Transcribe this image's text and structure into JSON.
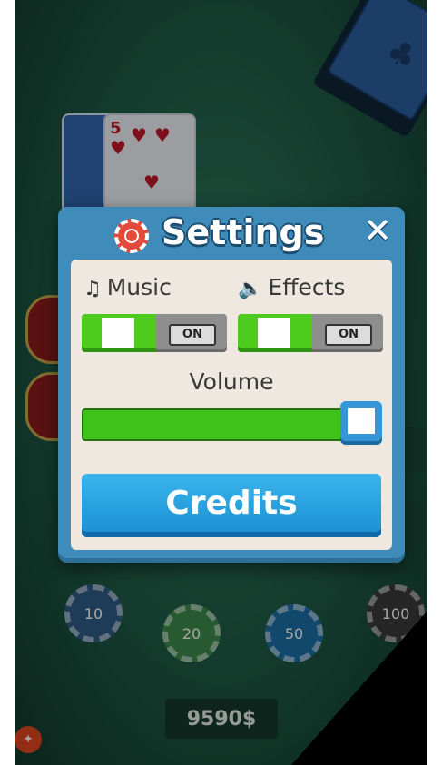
{
  "modal": {
    "title": "Settings",
    "close_symbol": "✕",
    "music": {
      "icon": "music-note-icon",
      "label": "Music",
      "state": "ON"
    },
    "effects": {
      "icon": "speaker-icon",
      "label": "Effects",
      "state": "ON"
    },
    "volume": {
      "label": "Volume",
      "level_percent": 100
    },
    "credits_label": "Credits"
  },
  "background": {
    "card_rank": "5",
    "chips": [
      "10",
      "20",
      "50",
      "100"
    ],
    "balance": "9590$"
  },
  "colors": {
    "modal_blue": "#3f8cbb",
    "toggle_green": "#4ecb1c",
    "credits_blue": "#1a8ed2",
    "table_green": "#2f7a5f"
  }
}
